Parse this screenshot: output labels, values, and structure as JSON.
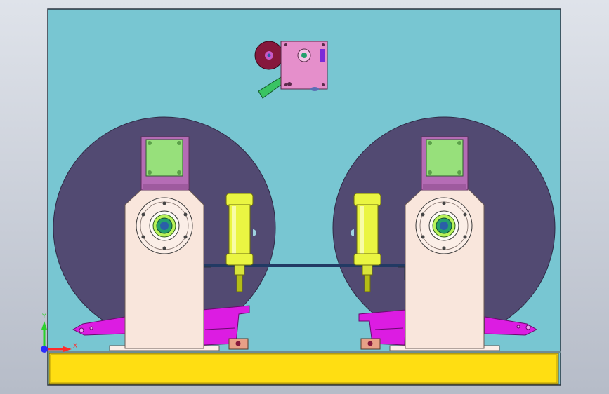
{
  "viewport": {
    "background_gradient": [
      "#dfe3ea",
      "#b6bcc8"
    ]
  },
  "colors": {
    "frame_bg": "#78c6d2",
    "frame_border": "#2b3440",
    "reel": "#524a72",
    "pedestal": "#f9e6dc",
    "motor_block": "#b56cb5",
    "mount_plate": "#97e07b",
    "cylinder": "#eaf542",
    "cylinder_dark": "#b4bd15",
    "guide_arm": "#dc1ce2",
    "top_housing": "#e58fcb",
    "roller": "#86183c",
    "guide_rod": "#39c463",
    "base_bar": "#ffde12",
    "small_block": "#e8a087",
    "shaft": "#24a06c",
    "flange": "#fbeee7"
  },
  "triad": {
    "x_label": "X",
    "y_label": "Y",
    "x_color": "#ff2a2a",
    "y_color": "#2ad02a",
    "z_color": "#2a2aff"
  },
  "parts": {
    "left_reel": "left-reel",
    "right_reel": "right-reel",
    "left_pedestal": "left-pedestal",
    "right_pedestal": "right-pedestal",
    "left_cylinder": "left-cylinder",
    "right_cylinder": "right-cylinder",
    "top_assembly": "top-housing",
    "base": "base-bar"
  }
}
